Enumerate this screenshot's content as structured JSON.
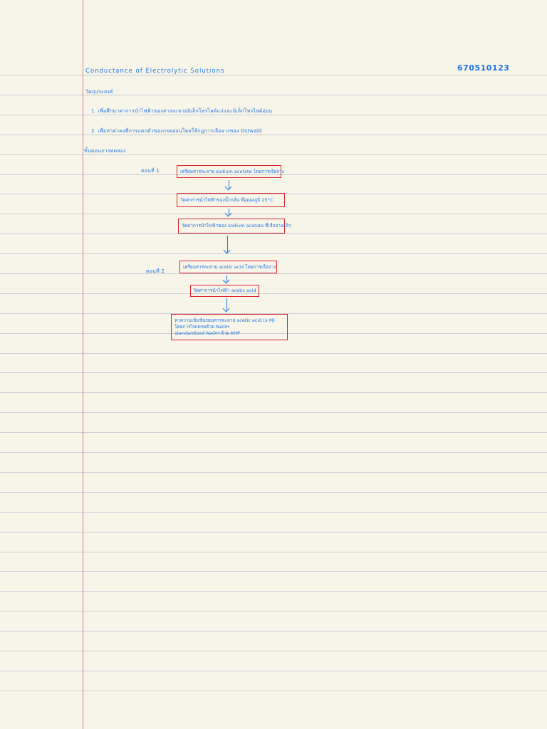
{
  "note": {
    "title": "Conductance of Electrolytic Solutions",
    "student_id": "670510123",
    "objectives_heading": "วัตถุประสงค์",
    "objectives": [
      "1. เพื่อศึกษาค่าการนำไฟฟ้าของสารละลายอิเล็กโทรไลต์แก่และอิเล็กโทรไลต์อ่อน",
      "2. เพื่อหาค่าคงที่การแตกตัวของกรดอ่อนโดยใช้กฎการเจือจางของ Ostwald"
    ],
    "procedure_heading": "ขั้นตอนการทดลอง",
    "part1": {
      "label": "ตอนที่ 1",
      "steps": [
        "เตรียมสารละลาย sodium acetate โดยการเจือจาง",
        "วัดค่าการนำไฟฟ้าของน้ำกลั่น ที่อุณหภูมิ 25°C",
        "วัดค่าการนำไฟฟ้าของ sodium acetate ที่เจือจางแล้ว"
      ]
    },
    "part2": {
      "label": "ตอนที่ 2",
      "steps": [
        "เตรียมสารละลาย acetic acid โดยการเจือจาง",
        "วัดค่าการนำไฟฟ้า acetic acid"
      ],
      "final_step_lines": [
        "หาความเข้มข้นของสารละลาย acetic acid (x M)",
        "โดยการไทเทรตด้วย NaOH",
        "standardized NaOH ด้วย KHP"
      ]
    }
  }
}
